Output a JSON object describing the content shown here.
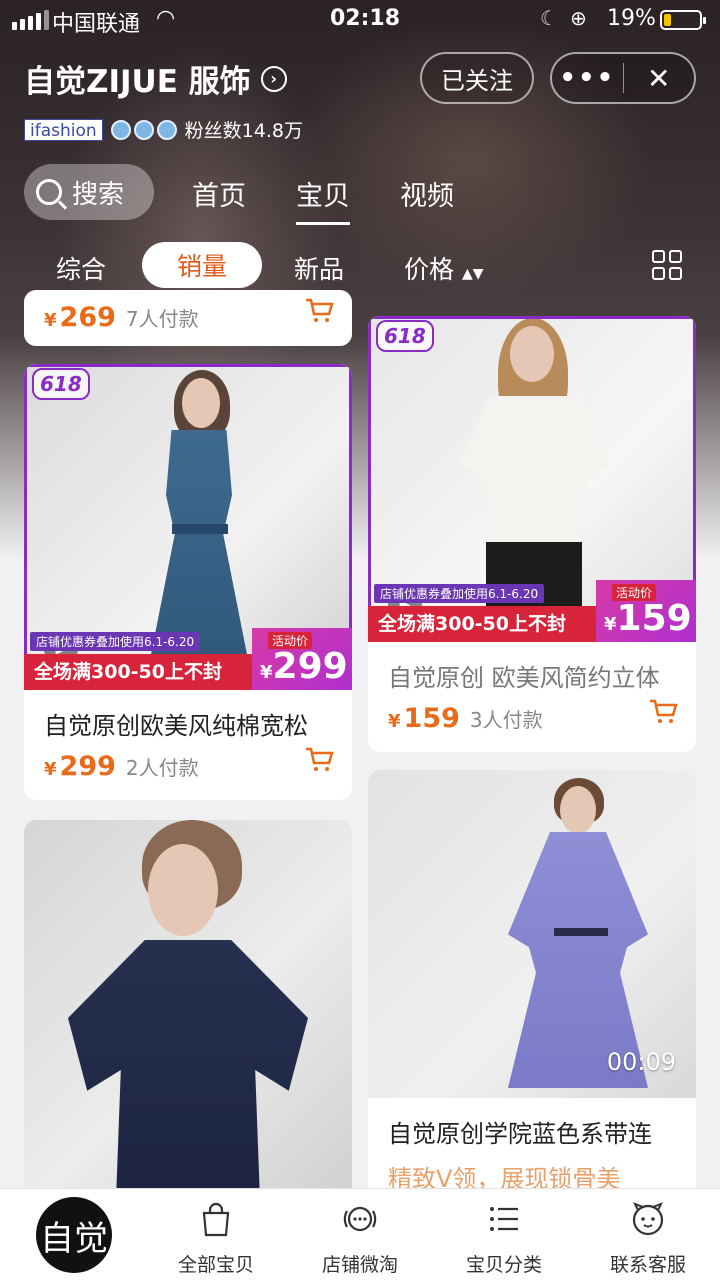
{
  "status_bar": {
    "carrier": "中国联通",
    "time": "02:18",
    "battery": "19%"
  },
  "store": {
    "name": "自觉ZIJUE 服饰",
    "follow_label": "已关注",
    "ifashion_label": "ifashion",
    "fans_text": "粉丝数14.8万",
    "capsule_more": "•••",
    "capsule_close": "✕"
  },
  "nav": {
    "search_label": "搜索",
    "tabs": [
      {
        "label": "首页"
      },
      {
        "label": "宝贝"
      },
      {
        "label": "视频"
      }
    ],
    "active_tab": "宝贝"
  },
  "sort": {
    "items": [
      {
        "label": "综合"
      },
      {
        "label": "销量"
      },
      {
        "label": "新品"
      },
      {
        "label": "价格"
      }
    ],
    "active": "销量"
  },
  "products": [
    {
      "title": "",
      "price": "269",
      "sold": "7人付款"
    },
    {
      "title": "自觉原创欧美风纯棉宽松",
      "price": "299",
      "sold": "2人付款",
      "tag": "618",
      "promo_text": "全场满300-50上不封",
      "promo_note": "店铺优惠券叠加使用6.1-6.20",
      "promo_badge": "活动价",
      "promo_price": "299"
    },
    {
      "title": "自觉原创 欧美风简约立体",
      "price": "159",
      "sold": "3人付款",
      "tag": "618",
      "promo_text": "全场满300-50上不封",
      "promo_note": "店铺优惠券叠加使用6.1-6.20",
      "promo_badge": "活动价",
      "promo_price": "159"
    },
    {
      "title": "",
      "price": "",
      "sold": ""
    },
    {
      "title": "自觉原创学院蓝色系带连",
      "subtitle": "精致V领，展现锁骨美",
      "duration": "00:09"
    }
  ],
  "tabbar": {
    "logo_text": "自觉",
    "items": [
      {
        "label": "全部宝贝",
        "icon": "bag-icon"
      },
      {
        "label": "店铺微淘",
        "icon": "chat-icon"
      },
      {
        "label": "宝贝分类",
        "icon": "list-icon"
      },
      {
        "label": "联系客服",
        "icon": "service-icon"
      }
    ]
  },
  "colors": {
    "accent": "#e96a19",
    "promo_red": "#d8243a",
    "promo_purple": "#8a2bc6"
  },
  "currency": "¥"
}
